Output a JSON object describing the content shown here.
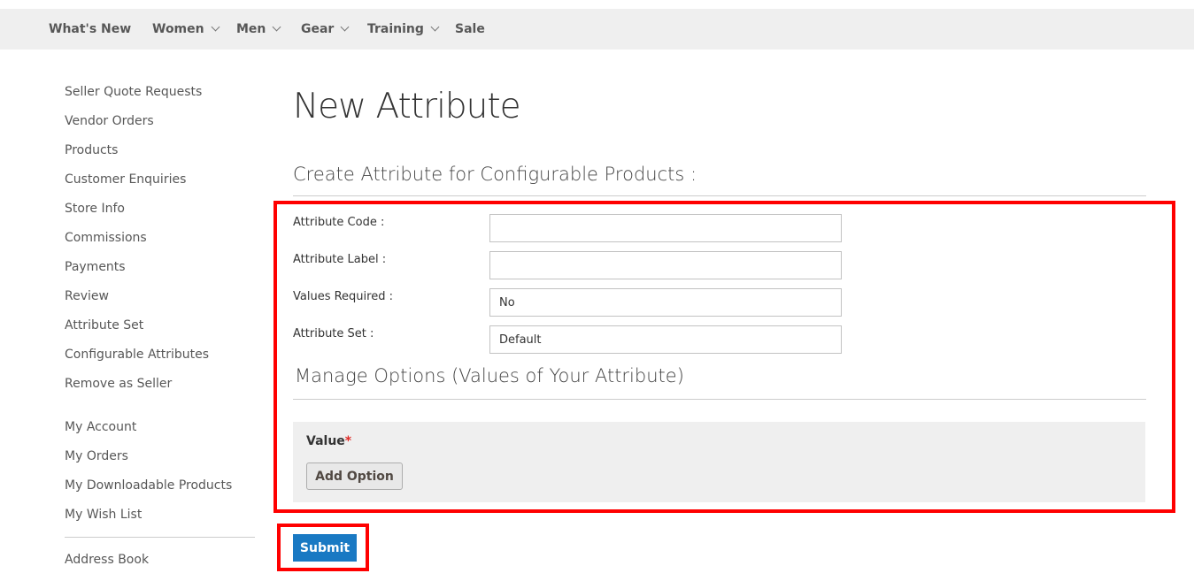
{
  "nav": {
    "items": [
      {
        "label": "What's New",
        "dropdown": false
      },
      {
        "label": "Women",
        "dropdown": true
      },
      {
        "label": "Men",
        "dropdown": true
      },
      {
        "label": "Gear",
        "dropdown": true
      },
      {
        "label": "Training",
        "dropdown": true
      },
      {
        "label": "Sale",
        "dropdown": false
      }
    ]
  },
  "sidebar": {
    "items": [
      "Seller Quote Requests",
      "Vendor Orders",
      "Products",
      "Customer Enquiries",
      "Store Info",
      "Commissions",
      "Payments",
      "Review",
      "Attribute Set",
      "Configurable Attributes",
      "Remove as Seller",
      "My Account",
      "My Orders",
      "My Downloadable Products",
      "My Wish List",
      "Address Book"
    ]
  },
  "page": {
    "title": "New Attribute",
    "section_title": "Create Attribute for Configurable Products :",
    "fields": [
      {
        "label": "Attribute Code :",
        "value": ""
      },
      {
        "label": "Attribute Label :",
        "value": ""
      },
      {
        "label": "Values Required :",
        "value": "No"
      },
      {
        "label": "Attribute Set :",
        "value": "Default"
      }
    ],
    "options_title": "Manage Options (Values of Your Attribute)",
    "value_label": "Value",
    "required_mark": "*",
    "add_option": "Add Option",
    "submit": "Submit"
  },
  "colors": {
    "highlight": "#ff0000",
    "primary": "#1979c3",
    "required": "#e02b27"
  }
}
